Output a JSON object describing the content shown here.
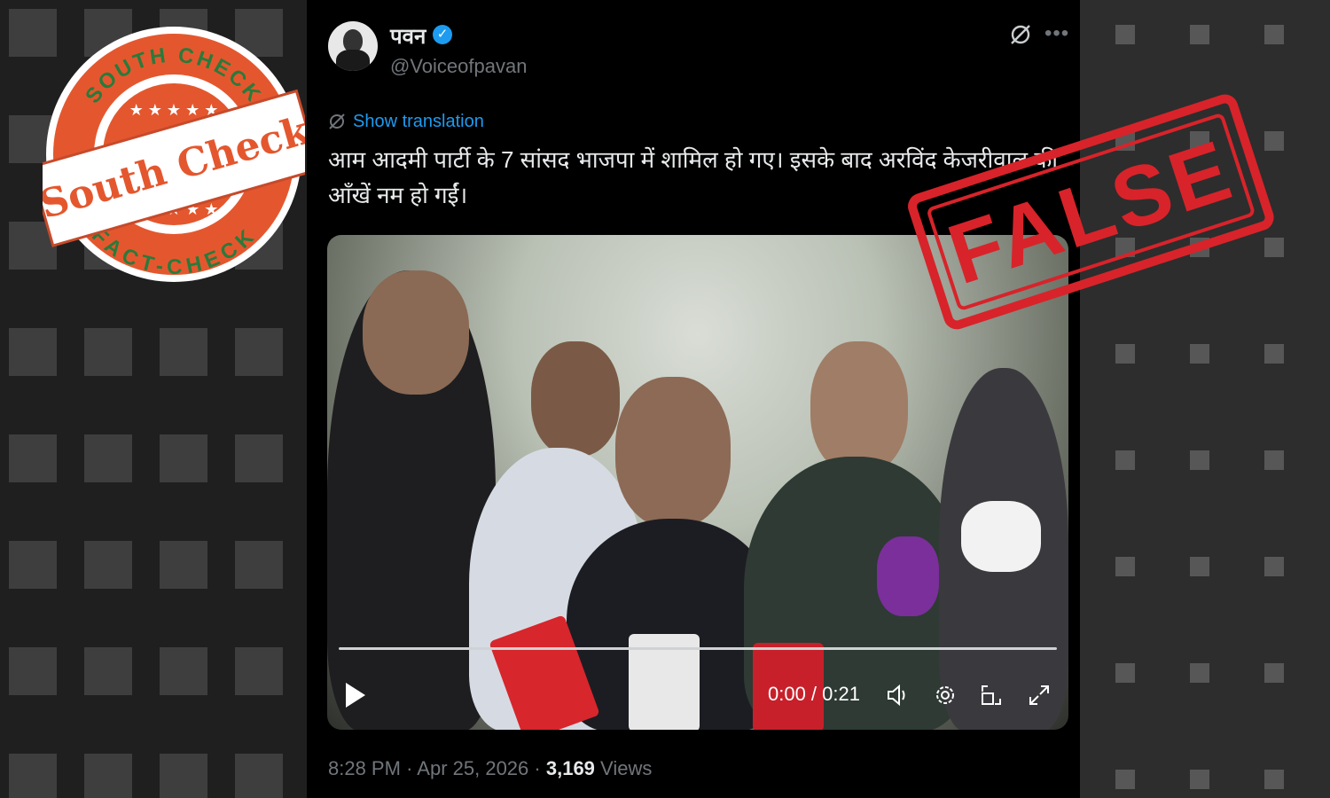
{
  "tweet": {
    "author_name": "पवन",
    "author_handle": "@Voiceofpavan",
    "show_translation": "Show translation",
    "text": "आम आदमी पार्टी के 7 सांसद भाजपा में शामिल हो गए। इसके बाद अरविंद केजरीवाल की आँखें नम हो गईं।",
    "time": "8:28 PM",
    "separator": "·",
    "date": "Apr 25, 2026",
    "views_count": "3,169",
    "views_label": "Views"
  },
  "video": {
    "time_display": "0:00 / 0:21",
    "progress": 0.0
  },
  "logo": {
    "top_text": "SOUTH CHECK",
    "bottom_text": "FACT-CHECK",
    "brand": "South Check"
  },
  "stamp": {
    "text": "FALSE",
    "color": "#d8232a"
  },
  "colors": {
    "accent": "#1d9bf0",
    "logo_orange": "#e4572e",
    "logo_green": "#2a7a3b"
  },
  "icons": {
    "verified": "verified-badge-icon",
    "grok": "grok-icon",
    "more": "more-icon",
    "play": "play-icon",
    "volume": "volume-icon",
    "settings": "settings-icon",
    "pip": "picture-in-picture-icon",
    "fullscreen": "fullscreen-icon"
  }
}
